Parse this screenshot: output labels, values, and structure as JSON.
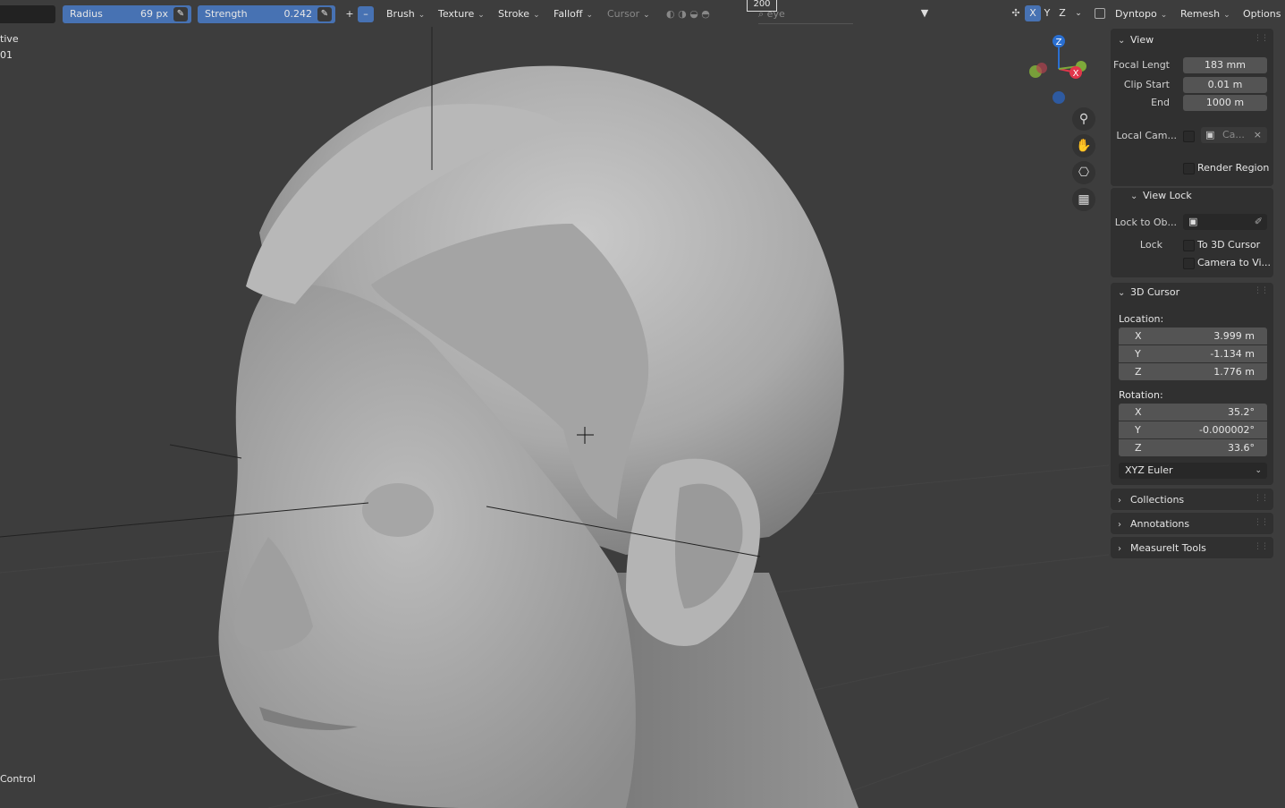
{
  "overlay": {
    "mode_line1": "tive",
    "mode_line2": "01",
    "bottom_status": "Control",
    "subtitle_number": "200"
  },
  "header": {
    "radius_label": "Radius",
    "radius_value": "69 px",
    "strength_label": "Strength",
    "strength_value": "0.242",
    "plus_label": "+",
    "minus_label": "–",
    "brush_label": "Brush",
    "texture_label": "Texture",
    "stroke_label": "Stroke",
    "falloff_label": "Falloff",
    "cursor_label": "Cursor",
    "search_text": "eye",
    "x_label": "X",
    "y_label": "Y",
    "z_label": "Z",
    "dyntopo_label": "Dyntopo",
    "remesh_label": "Remesh",
    "options_label": "Options"
  },
  "gizmo": {
    "z_label": "Z",
    "x_label": "X",
    "colors": {
      "z": "#2a6fd1",
      "x": "#e0364b",
      "y": "#7ea93a",
      "neg_y": "#6a8a36",
      "neg_z": "#2e5aa0"
    }
  },
  "sidebar": {
    "view": {
      "title": "View",
      "focal_label": "Focal Lengt",
      "focal_value": "183 mm",
      "clip_start_label": "Clip Start",
      "clip_start_value": "0.01 m",
      "end_label": "End",
      "end_value": "1000 m",
      "local_camera_label": "Local Cam...",
      "local_camera_value": "Ca...",
      "render_region_label": "Render Region"
    },
    "view_lock": {
      "title": "View Lock",
      "lock_to_label": "Lock to Ob...",
      "lock_label": "Lock",
      "to_3d_cursor_label": "To 3D Cursor",
      "camera_to_view_label": "Camera to Vi..."
    },
    "cursor3d": {
      "title": "3D Cursor",
      "location_label": "Location:",
      "location": [
        {
          "axis": "X",
          "value": "3.999 m"
        },
        {
          "axis": "Y",
          "value": "-1.134 m"
        },
        {
          "axis": "Z",
          "value": "1.776 m"
        }
      ],
      "rotation_label": "Rotation:",
      "rotation": [
        {
          "axis": "X",
          "value": "35.2°"
        },
        {
          "axis": "Y",
          "value": "-0.000002°"
        },
        {
          "axis": "Z",
          "value": "33.6°"
        }
      ],
      "rotation_mode": "XYZ Euler"
    },
    "collections_title": "Collections",
    "annotations_title": "Annotations",
    "measureit_title": "MeasureIt Tools"
  },
  "colors": {
    "accent": "#4772b3",
    "background": "#3d3d3d",
    "panel": "#303030",
    "field": "#545454"
  }
}
